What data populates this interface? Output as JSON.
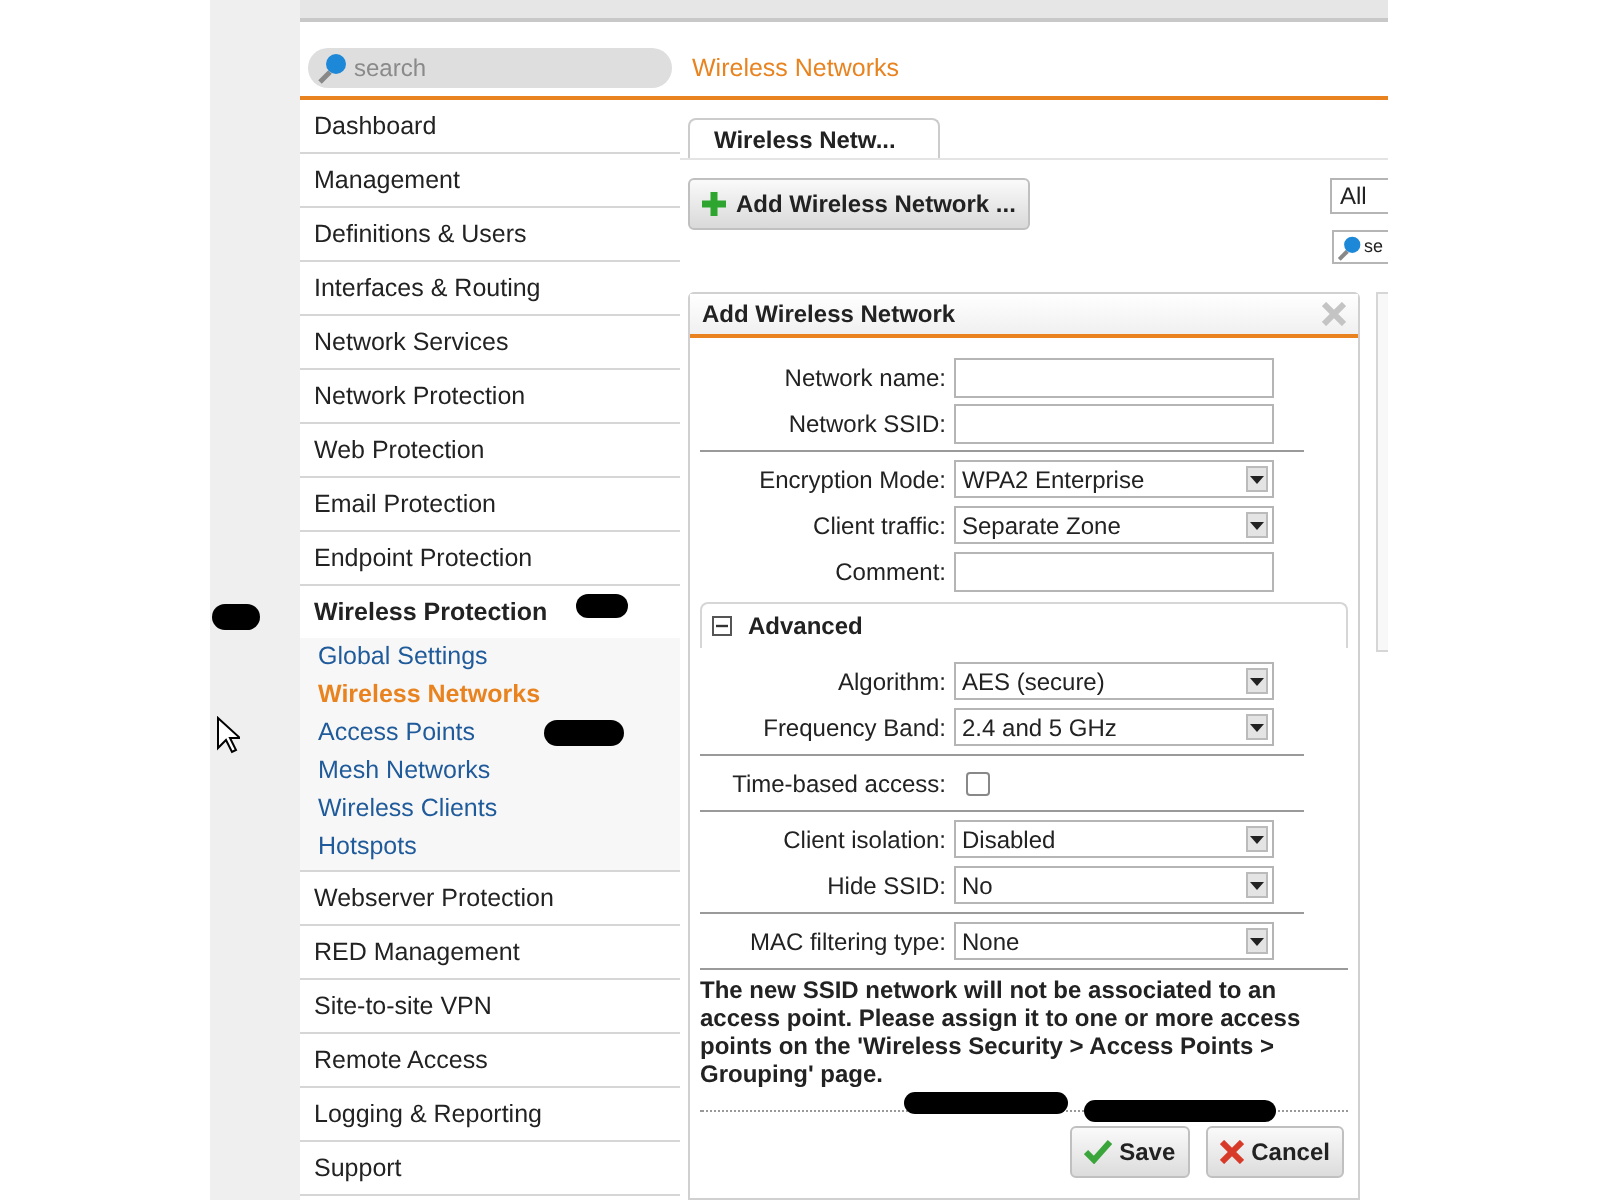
{
  "sidebar": {
    "search": {
      "placeholder": "search"
    },
    "items": [
      {
        "label": "Dashboard",
        "expanded": false
      },
      {
        "label": "Management",
        "expanded": false
      },
      {
        "label": "Definitions & Users",
        "expanded": false
      },
      {
        "label": "Interfaces & Routing",
        "expanded": false
      },
      {
        "label": "Network Services",
        "expanded": false
      },
      {
        "label": "Network Protection",
        "expanded": false
      },
      {
        "label": "Web Protection",
        "expanded": false
      },
      {
        "label": "Email Protection",
        "expanded": false
      },
      {
        "label": "Endpoint Protection",
        "expanded": false
      },
      {
        "label": "Wireless Protection",
        "expanded": true,
        "children": [
          {
            "label": "Global Settings",
            "selected": false
          },
          {
            "label": "Wireless Networks",
            "selected": true
          },
          {
            "label": "Access Points",
            "selected": false
          },
          {
            "label": "Mesh Networks",
            "selected": false
          },
          {
            "label": "Wireless Clients",
            "selected": false
          },
          {
            "label": "Hotspots",
            "selected": false
          }
        ]
      },
      {
        "label": "Webserver Protection",
        "expanded": false
      },
      {
        "label": "RED Management",
        "expanded": false
      },
      {
        "label": "Site-to-site VPN",
        "expanded": false
      },
      {
        "label": "Remote Access",
        "expanded": false
      },
      {
        "label": "Logging & Reporting",
        "expanded": false
      },
      {
        "label": "Support",
        "expanded": false
      }
    ]
  },
  "page_title": "Wireless Networks",
  "tabs": [
    {
      "label": "Wireless Netw...",
      "selected": true
    }
  ],
  "add_button": "Add Wireless Network ...",
  "filter": {
    "value": "All"
  },
  "list_search": {
    "placeholder": "se"
  },
  "dialog": {
    "title": "Add Wireless Network",
    "groups": [
      [
        {
          "kind": "text",
          "label": "Network name:"
        },
        {
          "kind": "text",
          "label": "Network SSID:"
        }
      ],
      [
        {
          "kind": "select",
          "label": "Encryption Mode:",
          "value": "WPA2 Enterprise"
        },
        {
          "kind": "select",
          "label": "Client traffic:",
          "value": "Separate Zone"
        },
        {
          "kind": "text",
          "label": "Comment:"
        }
      ]
    ],
    "advanced": {
      "title": "Advanced",
      "expanded": true,
      "groups": [
        [
          {
            "kind": "select",
            "label": "Algorithm:",
            "value": "AES (secure)"
          },
          {
            "kind": "select",
            "label": "Frequency Band:",
            "value": "2.4 and 5 GHz"
          }
        ],
        [
          {
            "kind": "checkbox",
            "label": "Time-based access:",
            "checked": false
          }
        ],
        [
          {
            "kind": "select",
            "label": "Client isolation:",
            "value": "Disabled"
          },
          {
            "kind": "select",
            "label": "Hide SSID:",
            "value": "No"
          }
        ],
        [
          {
            "kind": "select",
            "label": "MAC filtering type:",
            "value": "None"
          }
        ]
      ]
    },
    "note": "The new SSID network will not be associated to an access point. Please assign it to one or more access points on the 'Wireless Security > Access Points > Grouping' page.",
    "buttons": [
      {
        "kind": "save",
        "label": "Save"
      },
      {
        "kind": "cancel",
        "label": "Cancel"
      }
    ]
  }
}
